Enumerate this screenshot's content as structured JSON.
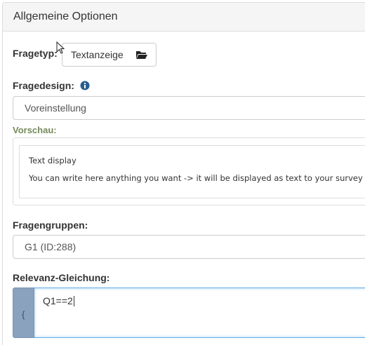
{
  "panel": {
    "title": "Allgemeine Optionen"
  },
  "question_type": {
    "label": "Fragetyp:",
    "button_label": "Textanzeige",
    "button_icon": "folder-open-icon"
  },
  "question_design": {
    "label": "Fragedesign:",
    "info_icon": "info-circle-icon",
    "selected": "Voreinstellung"
  },
  "preview": {
    "label": "Vorschau:",
    "title": "Text display",
    "body": "You can write here anything you want -> it will be displayed as text to your survey par"
  },
  "question_groups": {
    "label": "Fragengruppen:",
    "selected": "G1 (ID:288)"
  },
  "relevance": {
    "label": "Relevanz-Gleichung:",
    "addon": "{",
    "value": "Q1==2"
  },
  "colors": {
    "accent_green": "#768a5c",
    "addon_blue": "#8aa2be",
    "focus_border": "#66afe9"
  }
}
